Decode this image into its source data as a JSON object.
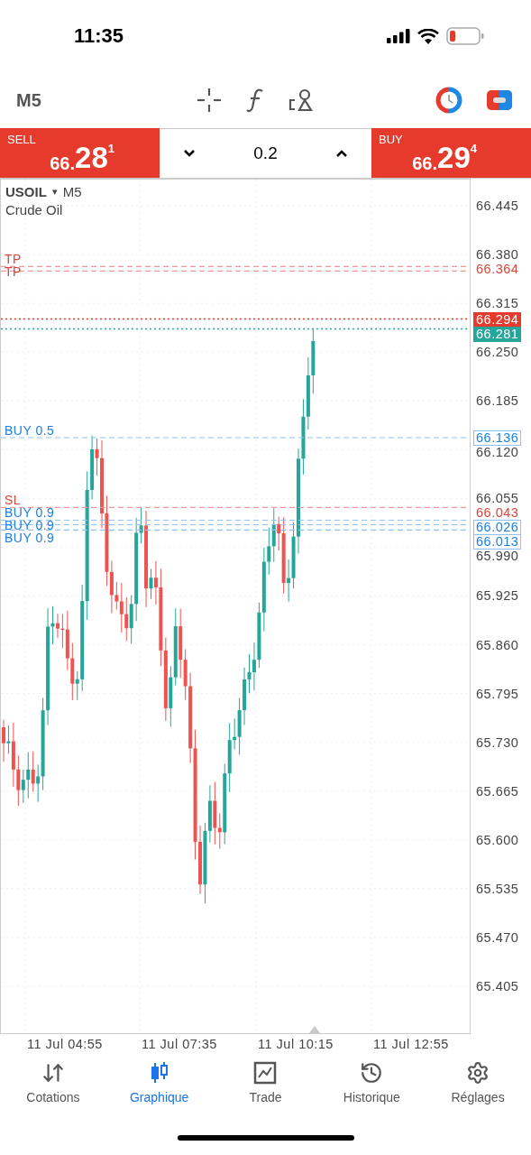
{
  "status_bar": {
    "time": "11:35"
  },
  "toolbar": {
    "timeframe": "M5"
  },
  "trade_panel": {
    "sell": {
      "label": "SELL",
      "price_prefix": "66.",
      "price_main": "28",
      "price_sup": "1"
    },
    "volume": "0.2",
    "buy": {
      "label": "BUY",
      "price_prefix": "66.",
      "price_main": "29",
      "price_sup": "4"
    }
  },
  "chart": {
    "symbol": "USOIL",
    "symbol_caret": "▾",
    "timeframe": "M5",
    "description": "Crude Oil",
    "price_ticks": [
      "66.445",
      "66.380",
      "66.315",
      "66.250",
      "66.185",
      "66.120",
      "66.055",
      "65.990",
      "65.925",
      "65.860",
      "65.795",
      "65.730",
      "65.665",
      "65.600",
      "65.535",
      "65.470",
      "65.405"
    ],
    "order_lines": [
      {
        "kind": "tp",
        "label": "TP",
        "price": "66.364"
      },
      {
        "kind": "tp",
        "label": "TP"
      },
      {
        "kind": "buy",
        "label": "BUY 0.5",
        "price": "66.136"
      },
      {
        "kind": "sl",
        "label": "SL",
        "price": "66.043"
      },
      {
        "kind": "buy",
        "label": "BUY 0.9",
        "price": "66.026"
      },
      {
        "kind": "buy",
        "label": "BUY 0.9"
      },
      {
        "kind": "buy",
        "label": "BUY 0.9",
        "price": "66.013"
      }
    ],
    "ask": "66.294",
    "bid": "66.281",
    "time_labels": [
      "11 Jul 04:55",
      "11 Jul 07:35",
      "11 Jul 10:15",
      "11 Jul 12:55"
    ]
  },
  "nav": [
    {
      "label": "Cotations",
      "kind": "quotes",
      "selected": false
    },
    {
      "label": "Graphique",
      "kind": "chart",
      "selected": true
    },
    {
      "label": "Trade",
      "kind": "trade",
      "selected": false
    },
    {
      "label": "Historique",
      "kind": "history",
      "selected": false
    },
    {
      "label": "Réglages",
      "kind": "settings",
      "selected": false
    }
  ]
}
